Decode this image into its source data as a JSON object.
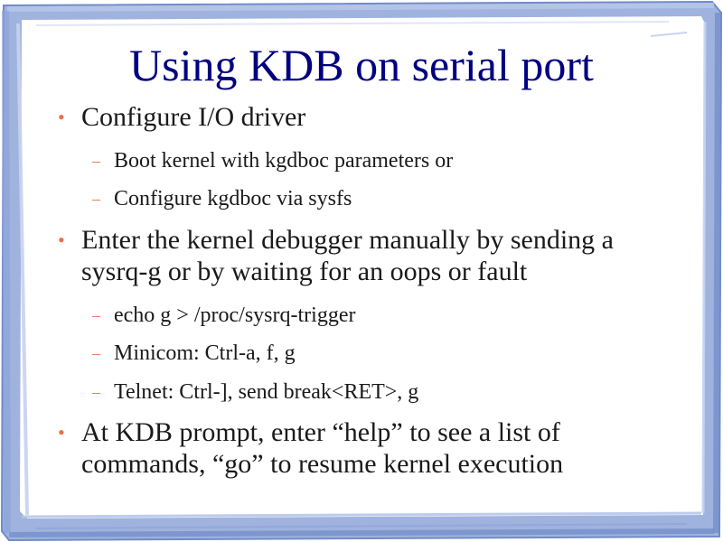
{
  "slide": {
    "title": "Using KDB on serial port",
    "bullet_marker": "•",
    "sub_marker": "–",
    "items": [
      {
        "text": "Configure I/O driver",
        "subitems": [
          "Boot kernel with kgdboc parameters or",
          "Configure kgdboc via sysfs"
        ]
      },
      {
        "text": "Enter the kernel debugger manually by sending a sysrq-g or by waiting for an oops or fault",
        "subitems": [
          "echo g > /proc/sysrq-trigger",
          "Minicom: Ctrl-a, f, g",
          "Telnet: Ctrl-], send break<RET>, g"
        ]
      },
      {
        "text": "At KDB prompt, enter “help” to see a list of commands, “go” to resume kernel execution",
        "subitems": []
      }
    ]
  },
  "colors": {
    "title": "#000080",
    "text": "#1a1a1a",
    "bullet": "#e8704a",
    "frame": "#8fa6d6",
    "frame_dark": "#5f7fc0"
  }
}
